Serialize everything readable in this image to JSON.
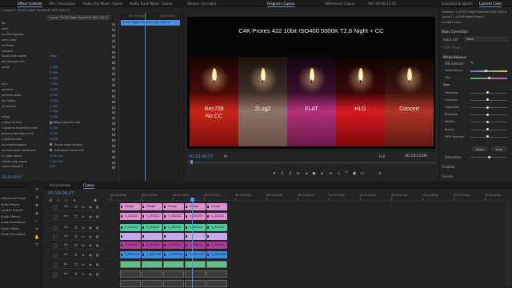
{
  "effect_controls": {
    "tabs": [
      "Effect Controls",
      "Bin: TimeLapse",
      "Audio Clip Mixer: Сцена",
      "Audio Track Mixer: Сцена"
    ],
    "source_label": "Главное * ZLOG2 Night Prores422 400 1/30 CC",
    "clip_name": "Сцена * ZLOG2 Night Prores422 400 1/30 CC",
    "timecode_start": "00:19:05:00",
    "timecode_end": "00:19:10:00",
    "timeline_clip": "ZLOG2 Night Prores422 400 1/30 CC",
    "rows": [
      {
        "label": "ion",
        "value": ""
      },
      {
        "label": "acity",
        "value": ""
      },
      {
        "label": "me Remapping",
        "value": ""
      },
      {
        "label": "cetri Color",
        "value": ""
      },
      {
        "label": "nd Mode",
        "value": ""
      },
      {
        "label": "ndInput",
        "value": ""
      },
      {
        "label": "Input color space",
        "value": "zlog2"
      },
      {
        "label": "dar shape(0.00)",
        "value": ""
      },
      {
        "label": "rency",
        "value": "1,000"
      },
      {
        "label": "",
        "value": "0,000"
      },
      {
        "label": "",
        "value": "0,000"
      },
      {
        "label": "oint",
        "value": "1,000"
      },
      {
        "label": "gamma",
        "value": "1,000"
      },
      {
        "label": "gamma lower",
        "value": "1,000"
      },
      {
        "label": "ain higher",
        "value": "1,000"
      },
      {
        "label": "off anchor",
        "value": "1,000"
      },
      {
        "label": "",
        "value": "1,000"
      },
      {
        "label": "offset",
        "value": "0,000"
      },
      {
        "label": "y gamma bias",
        "value": "0,000"
      },
      {
        "label": "y gamma boundary start",
        "value": "0,000"
      },
      {
        "label": "gamma boundary end",
        "value": "0,000"
      },
      {
        "label": "y gamma bias",
        "value": "0,000"
      },
      {
        "label": "ve compensation",
        "value": ""
      },
      {
        "label": "ve saturation correction",
        "value": ""
      },
      {
        "label": "te color space",
        "value": "2020_zn2"
      },
      {
        "label": "ndard color space",
        "value": "Y_Rec709"
      },
      {
        "label": "ndary output 0",
        "value": "100"
      }
    ],
    "checkbox_labels": [
      "Apply gamma bias",
      "Purple edge remove",
      "Saturation correction"
    ],
    "bottom_timecode": "00:19:06:07"
  },
  "program_monitor": {
    "tabs": [
      "Source: (no clips)",
      "Program: Сцена",
      "Reference: Сцена",
      "Ref: 00:00:21:15"
    ],
    "title_overlay": "C4K Prores 422 10bit ISO400 5000K T2,8 Night + CC",
    "panels": [
      {
        "label_line1": "Rec709",
        "label_line2": "No CC"
      },
      {
        "label_line1": "ZLog2",
        "label_line2": ""
      },
      {
        "label_line1": "FLAT",
        "label_line2": ""
      },
      {
        "label_line1": "HLG",
        "label_line2": ""
      },
      {
        "label_line1": "Concert",
        "label_line2": ""
      }
    ],
    "current_timecode": "00:19:06:07",
    "fit_label": "Fit",
    "quality_label": "Full",
    "duration_timecode": "00:19:22:06"
  },
  "lumetri": {
    "tabs": [
      "Essential Graphics",
      "Lumetri Color"
    ],
    "source_label": "Главное * 1_ZLOG2 Night Prores422 400 1/30 CC",
    "clip_label": "Сцена * 1_ZLOG2 Night Prores4",
    "section": "Lumetri Color",
    "basic_correction": "Basic Correction",
    "input_lut_label": "Input LUT",
    "input_lut_value": "None",
    "hdr_white_label": "HDR White",
    "white_balance": "White Balance",
    "wb_selector": "WB Selector",
    "rows": [
      "Temperature",
      "Tint",
      "Tone",
      "Exposure",
      "Contrast",
      "Highlights",
      "Shadows",
      "Whites",
      "Blacks",
      "HDR Specular"
    ],
    "reset_label": "Reset",
    "auto_label": "Auto",
    "saturation_label": "Saturation",
    "creative_label": "Creative",
    "curves_label": "Curves"
  },
  "project": {
    "items": [
      "Adjustment Layer",
      "Video Effects",
      "Lumetri Presets",
      "Audio Effects",
      "Audio Transitions",
      "Video Effects",
      "Video Transitions"
    ]
  },
  "timeline": {
    "tabs": [
      "Вступление",
      "Сцена"
    ],
    "timecode": "00:19:06:07",
    "ruler_labels": [
      "00:19:00:00",
      "00:19:05:00",
      "00:19:10:00",
      "00:19:15:00",
      "00:19:20:00",
      "00:19:25:00",
      "00:19:30:00",
      "00:19:35:00",
      "00:19:40:00",
      "00:19:45:00",
      "00:19:50:00",
      "00:19:55:00",
      "00:20:00:00"
    ],
    "tracks": [
      "V6",
      "V5",
      "V4",
      "V3",
      "V2",
      "V1",
      "A1",
      "A2"
    ],
    "clip_rows": [
      {
        "color": "#e08fd3",
        "clips": [
          "ZLog2",
          "ZLog2",
          "ZLog2",
          "ZLog2",
          "ZLog2"
        ]
      },
      {
        "color": "#e08fd3",
        "clips": [
          "1_ZLOG2",
          "1_ZLOG2",
          "1_ZLOG2",
          "1_ZLOG2",
          "1_ZLOG2"
        ]
      },
      {
        "color": "#4fc9a0",
        "clips": [
          "1_ZLOG2",
          "1_ZLOG2",
          "1_ZLOG2",
          "1_ZLOG2",
          "1_ZLOG2"
        ]
      },
      {
        "color": "#c7a8e8",
        "clips": [
          "",
          "",
          "",
          "",
          ""
        ]
      },
      {
        "color": "#b03a9b",
        "clips": [
          "1_ZLOG2",
          "1_ZLOG2",
          "1_ZLOG2",
          "1_ZLOG2",
          "1_ZLOG2"
        ]
      },
      {
        "color": "#3c8fe0",
        "clips": [
          "1_REC709",
          "1_REC709",
          "1_REC709",
          "1_REC709",
          "1_REC709"
        ]
      }
    ]
  }
}
